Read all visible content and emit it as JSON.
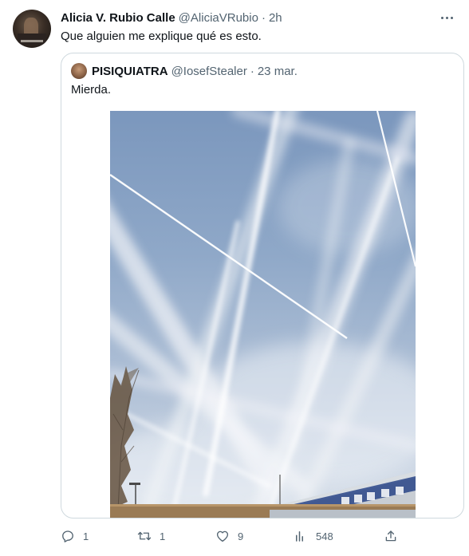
{
  "tweet": {
    "author_name": "Alicia V. Rubio Calle",
    "author_handle": "@AliciaVRubio",
    "separator": "·",
    "time": "2h",
    "text": "Que alguien me explique qué es esto."
  },
  "quote": {
    "author_name": "PISIQUIATRA",
    "author_handle": "@IosefStealer",
    "separator": "·",
    "time": "23 mar.",
    "text": "Mierda."
  },
  "actions": {
    "replies": "1",
    "retweets": "1",
    "likes": "9",
    "views": "548"
  },
  "icons": [
    "more-icon",
    "reply-icon",
    "retweet-icon",
    "like-icon",
    "views-icon",
    "share-icon"
  ]
}
